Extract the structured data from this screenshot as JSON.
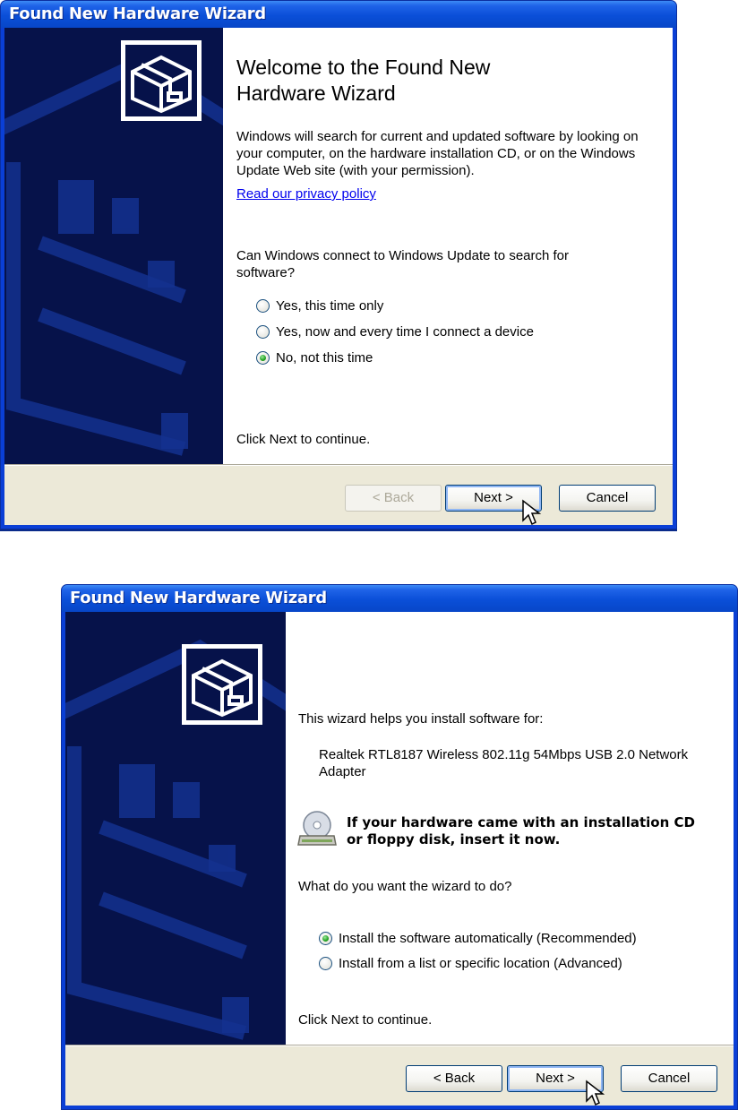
{
  "wizard1": {
    "title": "Found New Hardware Wizard",
    "heading": "Welcome to the Found New Hardware Wizard",
    "description": "Windows will search for current and updated software by looking on your computer, on the hardware installation CD, or on the Windows Update Web site (with your permission).",
    "privacy_link": "Read our privacy policy",
    "question": "Can Windows connect to Windows Update to search for software?",
    "options": [
      {
        "label": "Yes, this time only",
        "checked": false
      },
      {
        "label": "Yes, now and every time I connect a device",
        "checked": false
      },
      {
        "label": "No, not this time",
        "checked": true
      }
    ],
    "continue_text": "Click Next to continue.",
    "back_label": "< Back",
    "next_label": "Next >",
    "cancel_label": "Cancel"
  },
  "wizard2": {
    "title": "Found New Hardware Wizard",
    "intro": "This wizard helps you install software for:",
    "device_name": "Realtek RTL8187 Wireless 802.11g 54Mbps USB 2.0 Network Adapter",
    "cd_notice": "If your hardware came with an installation CD or floppy disk, insert it now.",
    "question": "What do you want the wizard to do?",
    "options": [
      {
        "label": "Install the software automatically (Recommended)",
        "checked": true
      },
      {
        "label": "Install from a list or specific location (Advanced)",
        "checked": false
      }
    ],
    "continue_text": "Click Next to continue.",
    "back_label": "< Back",
    "next_label": "Next >",
    "cancel_label": "Cancel"
  }
}
